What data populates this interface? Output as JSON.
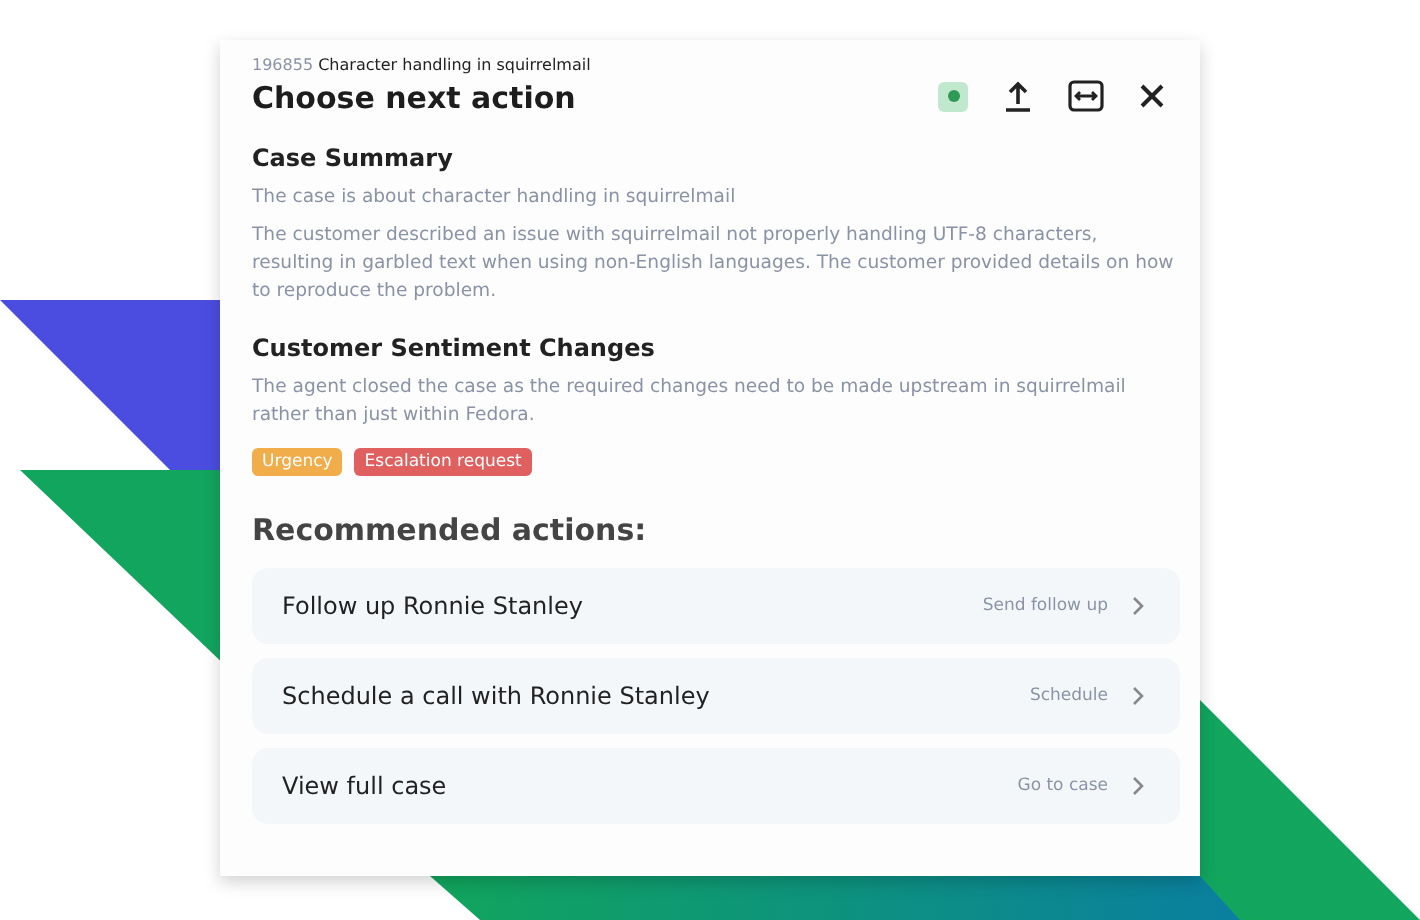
{
  "header": {
    "case_id": "196855",
    "case_title": "Character handling in squirrelmail",
    "title": "Choose next action"
  },
  "sections": [
    {
      "heading": "Case Summary",
      "paragraphs": [
        "The case is about character handling in squirrelmail",
        "The customer described an issue with squirrelmail not properly handling UTF-8 characters, resulting in garbled text when using non-English languages. The customer provided details on how to reproduce the problem."
      ]
    },
    {
      "heading": "Customer Sentiment Changes",
      "paragraphs": [
        "The agent closed the case as the required changes need to be made upstream in squirrelmail rather than just within Fedora."
      ]
    }
  ],
  "tags": [
    {
      "label": "Urgency",
      "color": "#f2ad4b"
    },
    {
      "label": "Escalation request",
      "color": "#e0605f"
    }
  ],
  "recommended": {
    "heading": "Recommended actions:",
    "actions": [
      {
        "label": "Follow up Ronnie Stanley",
        "action": "Send follow up"
      },
      {
        "label": "Schedule a call with Ronnie Stanley",
        "action": "Schedule"
      },
      {
        "label": "View full case",
        "action": "Go to case"
      }
    ]
  }
}
